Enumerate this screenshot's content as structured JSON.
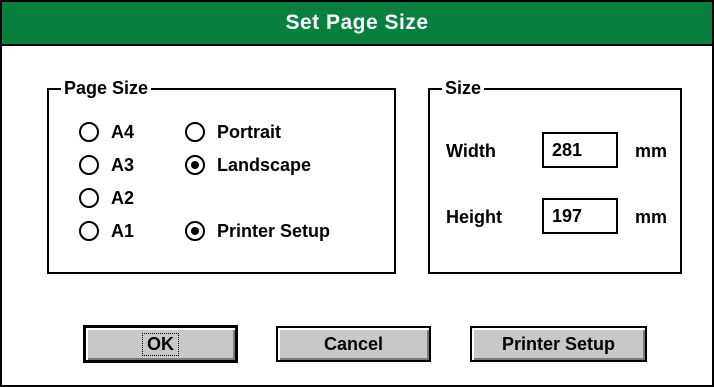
{
  "dialog": {
    "title": "Set Page Size",
    "colors": {
      "titlebar": "#077f3d",
      "button_face": "#c8c8c8"
    }
  },
  "page_size_group": {
    "title": "Page Size",
    "sizes": [
      {
        "label": "A4",
        "checked": false
      },
      {
        "label": "A3",
        "checked": false
      },
      {
        "label": "A2",
        "checked": false
      },
      {
        "label": "A1",
        "checked": false
      }
    ],
    "orientations": [
      {
        "label": "Portrait",
        "checked": false
      },
      {
        "label": "Landscape",
        "checked": true
      },
      {
        "label": "Printer Setup",
        "checked": true
      }
    ]
  },
  "size_group": {
    "title": "Size",
    "width_label": "Width",
    "width_value": "281",
    "height_label": "Height",
    "height_value": "197",
    "unit": "mm"
  },
  "buttons": {
    "ok": "OK",
    "cancel": "Cancel",
    "printer_setup": "Printer Setup"
  }
}
